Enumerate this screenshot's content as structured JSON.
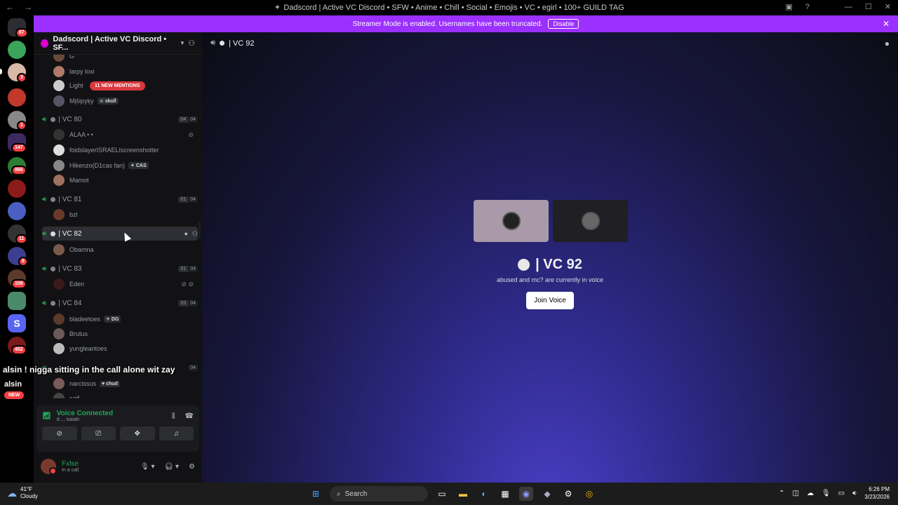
{
  "window": {
    "title": "Dadscord | Active VC Discord • SFW • Anime • Chill • Social • Emojis • VC • egirl • 100+ GUILD TAG"
  },
  "banner": {
    "message": "Streamer Mode is enabled. Usernames have been truncated.",
    "button": "Disable"
  },
  "rail": {
    "badges": [
      "87",
      "3",
      "1",
      "147",
      "866",
      "11",
      "8",
      "109",
      "452"
    ],
    "new_label": "NEW",
    "s_letter": "S"
  },
  "guild": {
    "name": "Dadscord | Active VC Discord • SF...",
    "mentions": "11 NEW MENTIONS"
  },
  "channels": {
    "partial_user_g": "G",
    "u_larpy": "larpy loxi",
    "u_light": "Light",
    "u_misipyky": "Mįšipyķy",
    "tag_skull": "skull",
    "vc80": "VC 80",
    "vc80_count": [
      "04",
      "04"
    ],
    "u_alaa": "ALAA • •",
    "u_foid": "foidslayerISRAELIscreenshotter",
    "u_hikenzo": "Hikenzo(D1cas fan)",
    "tag_cas": "CAS",
    "u_mamot": "Mamot",
    "vc81": "VC 81",
    "vc81_count": [
      "01",
      "04"
    ],
    "u_bzl": "bzl",
    "vc82": "VC 82",
    "u_obamna": "Obamna",
    "vc83": "VC 83",
    "vc83_count": [
      "01",
      "04"
    ],
    "u_eden": "Eden",
    "vc84": "VC 84",
    "vc84_count": [
      "03",
      "04"
    ],
    "u_bladeetoes": "bladeetoes",
    "tag_dg": "DG",
    "u_brutus": "Brutus",
    "u_yungleantoes": "yungleantoes",
    "vc85_count": "04",
    "u_narcissus": "narcissus",
    "tag_chud": "chud",
    "u_saif": "saif"
  },
  "overlay": {
    "text": "alsin ! nigga sitting in the call alone wit zay",
    "text2": "alsin"
  },
  "voice": {
    "status": "Voice Connected",
    "sub": "d..., Isaiah"
  },
  "me": {
    "name": "Fxlse",
    "status": "In a call"
  },
  "main": {
    "header": "VC 92",
    "title": "VC 92",
    "subtitle": "abused and mc? are currently in voice",
    "join": "Join Voice"
  },
  "taskbar": {
    "temp": "41°F",
    "cond": "Cloudy",
    "search": "Search",
    "time": "6:26 PM",
    "date": "3/23/2026"
  }
}
